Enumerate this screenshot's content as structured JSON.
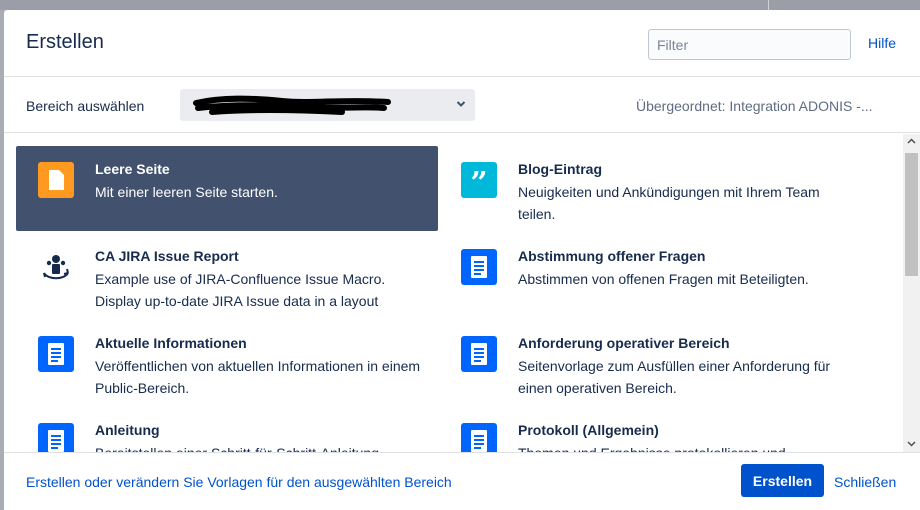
{
  "dialog": {
    "title": "Erstellen",
    "filter_placeholder": "Filter",
    "help_label": "Hilfe"
  },
  "space": {
    "label": "Bereich auswählen",
    "selected_value": "",
    "parent_info": "Übergeordnet: Integration ADONIS -..."
  },
  "templates": [
    {
      "title": "Leere Seite",
      "description": "Mit einer leeren Seite starten.",
      "icon": "blank-page-icon",
      "selected": true
    },
    {
      "title": "Blog-Eintrag",
      "description": "Neuigkeiten und Ankündigungen mit Ihrem Team teilen.",
      "icon": "quote-icon",
      "selected": false
    },
    {
      "title": "CA JIRA Issue Report",
      "description": "Example use of JIRA-Confluence Issue Macro. Display up-to-date JIRA Issue data in a layout",
      "icon": "issue-report-icon",
      "selected": false
    },
    {
      "title": "Abstimmung offener Fragen",
      "description": "Abstimmen von offenen Fragen mit Beteiligten.",
      "icon": "document-icon",
      "selected": false
    },
    {
      "title": "Aktuelle Informationen",
      "description": "Veröffentlichen von aktuellen Informationen in einem Public-Bereich.",
      "icon": "document-icon",
      "selected": false
    },
    {
      "title": "Anforderung operativer Bereich",
      "description": "Seitenvorlage zum Ausfüllen einer Anforderung für einen operativen Bereich.",
      "icon": "document-icon",
      "selected": false
    },
    {
      "title": "Anleitung",
      "description": "Bereitstellen einer Schritt-für-Schritt-Anleitung",
      "icon": "document-icon",
      "selected": false
    },
    {
      "title": "Protokoll (Allgemein)",
      "description": "Themen und Ergebnisse protokollieren und",
      "icon": "document-icon",
      "selected": false
    }
  ],
  "footer": {
    "templates_link": "Erstellen oder verändern Sie Vorlagen für den ausgewählten Bereich",
    "create_label": "Erstellen",
    "close_label": "Schließen"
  },
  "colors": {
    "accent": "#0052cc",
    "selected_bg": "#42526e",
    "blank_icon": "#ff991f",
    "blog_icon": "#00b8d9",
    "doc_icon": "#0065ff"
  }
}
